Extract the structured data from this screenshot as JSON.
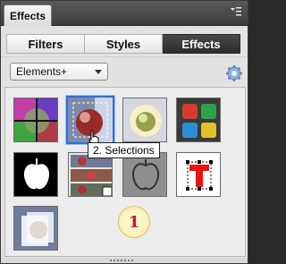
{
  "window": {
    "title": "Effects"
  },
  "tabs": [
    {
      "label": "Filters",
      "active": false
    },
    {
      "label": "Styles",
      "active": false
    },
    {
      "label": "Effects",
      "active": true
    }
  ],
  "toolbar": {
    "category_value": "Elements+",
    "settings_icon": "gear-icon"
  },
  "grid": {
    "items": [
      {
        "id": "effect-1",
        "icon": "color-quadrant-photo"
      },
      {
        "id": "effect-2",
        "icon": "selection-apple-photo",
        "selected": true
      },
      {
        "id": "effect-3",
        "icon": "glow-apple-photo"
      },
      {
        "id": "effect-4",
        "icon": "color-squares-grid"
      },
      {
        "id": "effect-5",
        "icon": "apple-silhouette"
      },
      {
        "id": "effect-6",
        "icon": "photo-strip"
      },
      {
        "id": "effect-7",
        "icon": "apple-outline"
      },
      {
        "id": "effect-8",
        "icon": "text-transform-T"
      },
      {
        "id": "effect-9",
        "icon": "frosted-apple-photo"
      }
    ],
    "tooltip": "2. Selections",
    "badge": "1"
  },
  "colors": {
    "accent": "#2f6fd8",
    "active_tab": "#333333",
    "badge_text": "#d11a1a"
  }
}
